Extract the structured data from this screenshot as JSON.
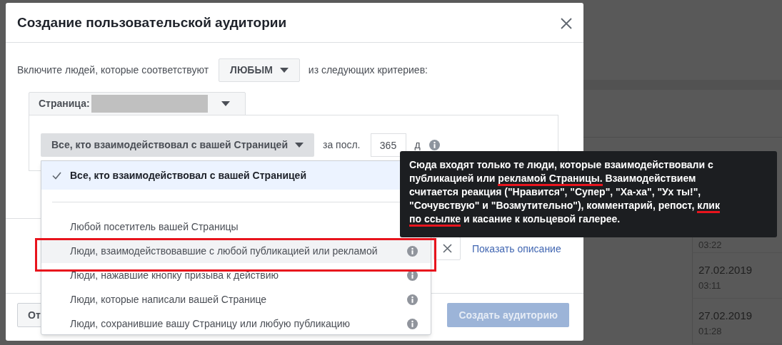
{
  "dialog": {
    "title": "Создание пользовательской аудитории"
  },
  "intro": {
    "before": "Включите людей, которые соответствуют",
    "match": "ЛЮБЫМ",
    "after": "из следующих критериев:"
  },
  "source": {
    "label": "Страница:"
  },
  "rule": {
    "event": "Все, кто взаимодействовал с вашей Страницей",
    "period_label": "за посл.",
    "days": "365",
    "unit": "д"
  },
  "menu": {
    "items": [
      {
        "label": "Все, кто взаимодействовал с вашей Страницей",
        "selected": true,
        "highlighted": false,
        "info": false,
        "annotated": false
      },
      {
        "label": "Любой посетитель вашей Страницы",
        "selected": false,
        "highlighted": false,
        "info": false,
        "annotated": false
      },
      {
        "label": "Люди, взаимодействовавшие с любой публикацией или рекламой",
        "selected": false,
        "highlighted": true,
        "info": true,
        "annotated": true
      },
      {
        "label": "Люди, нажавшие кнопку призыва к действию",
        "selected": false,
        "highlighted": false,
        "info": true,
        "annotated": false
      },
      {
        "label": "Люди, которые написали вашей Странице",
        "selected": false,
        "highlighted": false,
        "info": true,
        "annotated": false
      },
      {
        "label": "Люди, сохранившие вашу Страницу или любую публикацию",
        "selected": false,
        "highlighted": false,
        "info": true,
        "annotated": false
      }
    ]
  },
  "behind": {
    "link": "Показать описание"
  },
  "footer": {
    "cancel": "От",
    "create": {
      "label": "Создать аудиторию",
      "disabled": true
    }
  },
  "tooltip": {
    "segments": [
      {
        "text": "Сюда входят только те люди, которые взаимодействовали с публикацией или ",
        "underlined": false
      },
      {
        "text": "рекламой Страницы.",
        "underlined": true
      },
      {
        "text": " Взаимодействием считается реакция (\"Нравится\", \"Супер\", \"Ха-ха\", \"Ух ты!\", \"Сочувствую\" и \"Возмутительно\"), комментарий, репост, ",
        "underlined": false
      },
      {
        "text": "клик по ссылке",
        "underlined": true
      },
      {
        "text": " и касание к кольцевой галерее.",
        "underlined": false
      }
    ]
  },
  "background_table": {
    "rows": [
      {
        "time": "03:22"
      },
      {
        "date": "27.02.2019",
        "time": "03:11"
      },
      {
        "date": "27.02.2019",
        "time": "01:28"
      }
    ]
  }
}
